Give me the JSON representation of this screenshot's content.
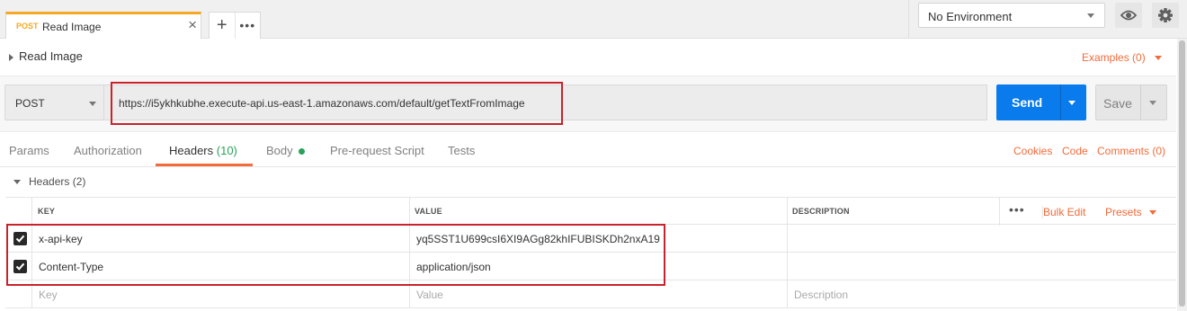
{
  "tabstrip": {
    "active_tab": {
      "method": "POST",
      "title": "Read Image",
      "close": "×"
    },
    "new_tab": "+",
    "more": "•••"
  },
  "environment": {
    "selected": "No Environment"
  },
  "request": {
    "title": "Read Image",
    "examples_label": "Examples (0)",
    "method": "POST",
    "url": "https://i5ykhkubhe.execute-api.us-east-1.amazonaws.com/default/getTextFromImage",
    "send_label": "Send",
    "save_label": "Save"
  },
  "subtabs": {
    "items": [
      {
        "label": "Params"
      },
      {
        "label": "Authorization"
      },
      {
        "label": "Headers",
        "count": "(10)"
      },
      {
        "label": "Body"
      },
      {
        "label": "Pre-request Script"
      },
      {
        "label": "Tests"
      }
    ],
    "active": "Headers",
    "right_links": [
      "Cookies",
      "Code",
      "Comments (0)"
    ]
  },
  "headers_section": {
    "title": "Headers (2)",
    "columns": {
      "key": "KEY",
      "value": "VALUE",
      "description": "DESCRIPTION"
    },
    "more": "•••",
    "bulk_edit": "Bulk Edit",
    "presets": "Presets",
    "rows": [
      {
        "checked": true,
        "key": "x-api-key",
        "value": "yq5SST1U699csI6XI9AGg82khIFUBISKDh2nxA19",
        "description": ""
      },
      {
        "checked": true,
        "key": "Content-Type",
        "value": "application/json",
        "description": ""
      }
    ],
    "placeholders": {
      "key": "Key",
      "value": "Value",
      "description": "Description"
    }
  },
  "colors": {
    "accent_orange": "#f26b3a",
    "send_blue": "#097bed",
    "highlight_red": "#c8232c",
    "body_dot_green": "#27a35a",
    "post_method": "#f6a823"
  }
}
